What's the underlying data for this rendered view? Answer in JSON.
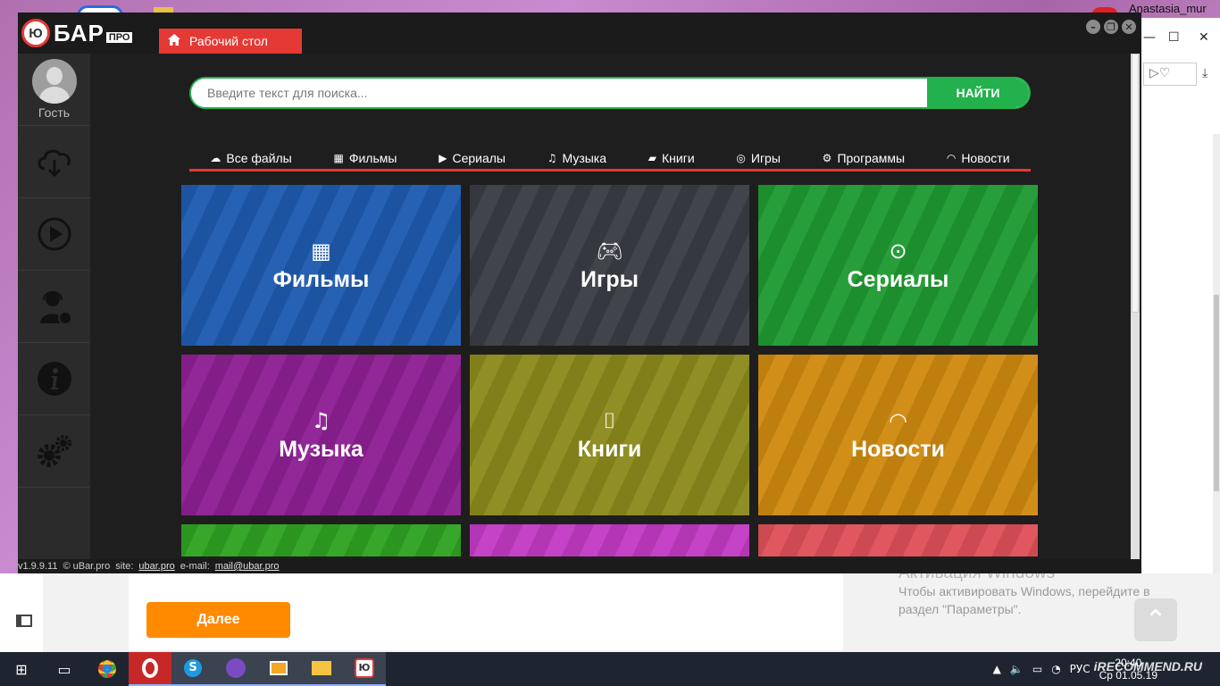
{
  "background": {
    "user_name": "Anastasia_mur",
    "next_button": "Далее",
    "activation_title": "Активация Windows",
    "activation_line1": "Чтобы активировать Windows, перейдите в",
    "activation_line2": "раздел \"Параметры\"."
  },
  "taskbar": {
    "language": "РУС",
    "time": "20:40",
    "date": "Ср 01.05.19",
    "watermark": "iRECOMMEND.RU"
  },
  "app": {
    "logo_text": "БАР",
    "logo_pro": "ПРО",
    "logo_mark": "Ю",
    "home_tab": "Рабочий стол",
    "guest_label": "Гость",
    "search_placeholder": "Введите текст для поиска...",
    "search_button": "НАЙТИ",
    "categories": [
      {
        "label": "Все файлы",
        "icon": "cloud-download-icon"
      },
      {
        "label": "Фильмы",
        "icon": "film-icon"
      },
      {
        "label": "Сериалы",
        "icon": "play-circle-icon"
      },
      {
        "label": "Музыка",
        "icon": "music-icon"
      },
      {
        "label": "Книги",
        "icon": "book-icon"
      },
      {
        "label": "Игры",
        "icon": "gamepad-icon"
      },
      {
        "label": "Программы",
        "icon": "gear-icon"
      },
      {
        "label": "Новости",
        "icon": "rss-icon"
      }
    ],
    "tiles": [
      {
        "label": "Фильмы",
        "color": "#1e5bb0"
      },
      {
        "label": "Игры",
        "color": "#3a3d44"
      },
      {
        "label": "Сериалы",
        "color": "#1f9a32"
      },
      {
        "label": "Музыка",
        "color": "#8e1f94"
      },
      {
        "label": "Книги",
        "color": "#8b8a1c"
      },
      {
        "label": "Новости",
        "color": "#cf8a10"
      }
    ],
    "status": {
      "version": "v1.9.9.11",
      "copyright": "© uBar.pro",
      "site_label": "site:",
      "site": "ubar.pro",
      "email_label": "e-mail:",
      "email": "mail@ubar.pro"
    }
  }
}
